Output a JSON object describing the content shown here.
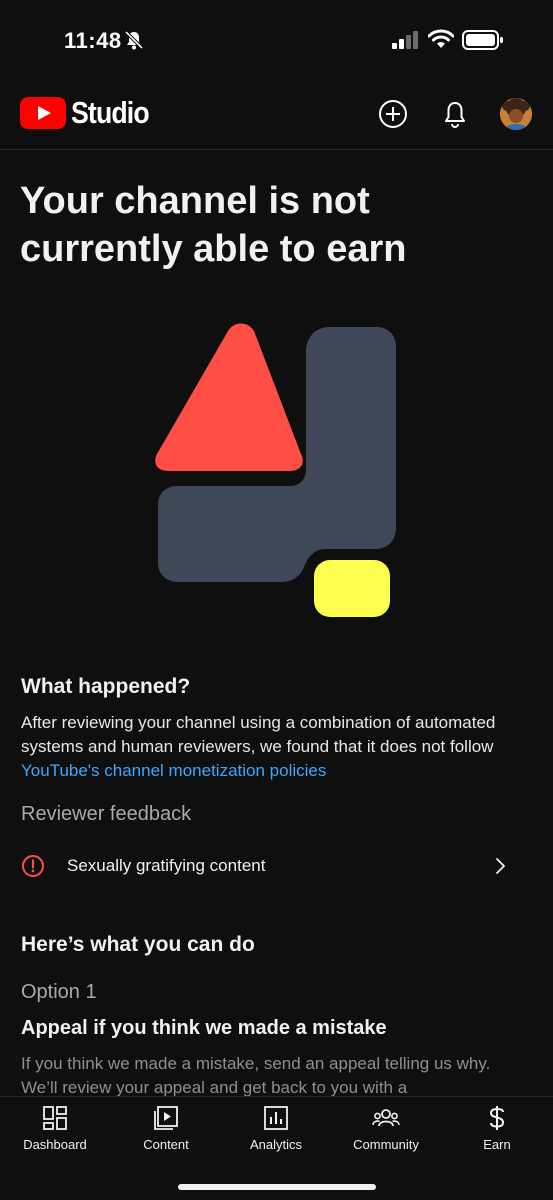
{
  "status_bar": {
    "time": "11:48"
  },
  "header": {
    "app_name": "Studio",
    "brand_red": "#ff0000"
  },
  "page": {
    "title": "Your channel is not currently able to earn",
    "what_happened": {
      "heading": "What happened?",
      "body_prefix": "After reviewing your channel using a combination of automated systems and human reviewers, we found that it does not follow ",
      "link_text": "YouTube's channel monetization policies"
    },
    "reviewer_feedback": {
      "label": "Reviewer feedback",
      "items": [
        {
          "text": "Sexually gratifying content"
        }
      ]
    },
    "what_you_can_do": {
      "heading": "Here’s what you can do",
      "option_label": "Option 1",
      "option_title": "Appeal if you think we made a mistake",
      "option_body": "If you think we made a mistake, send an appeal telling us why. We’ll review your appeal and get back to you with a"
    }
  },
  "bottom_nav": {
    "items": [
      {
        "label": "Dashboard",
        "icon": "dashboard-icon"
      },
      {
        "label": "Content",
        "icon": "content-icon"
      },
      {
        "label": "Analytics",
        "icon": "analytics-icon"
      },
      {
        "label": "Community",
        "icon": "community-icon"
      },
      {
        "label": "Earn",
        "icon": "earn-icon"
      }
    ]
  },
  "colors": {
    "background": "#0f0f0f",
    "link": "#3ea6ff",
    "warning": "#ff4e45",
    "illustration_red": "#ff4e45",
    "illustration_slate": "#3f4859",
    "illustration_yellow": "#ffff4f"
  }
}
